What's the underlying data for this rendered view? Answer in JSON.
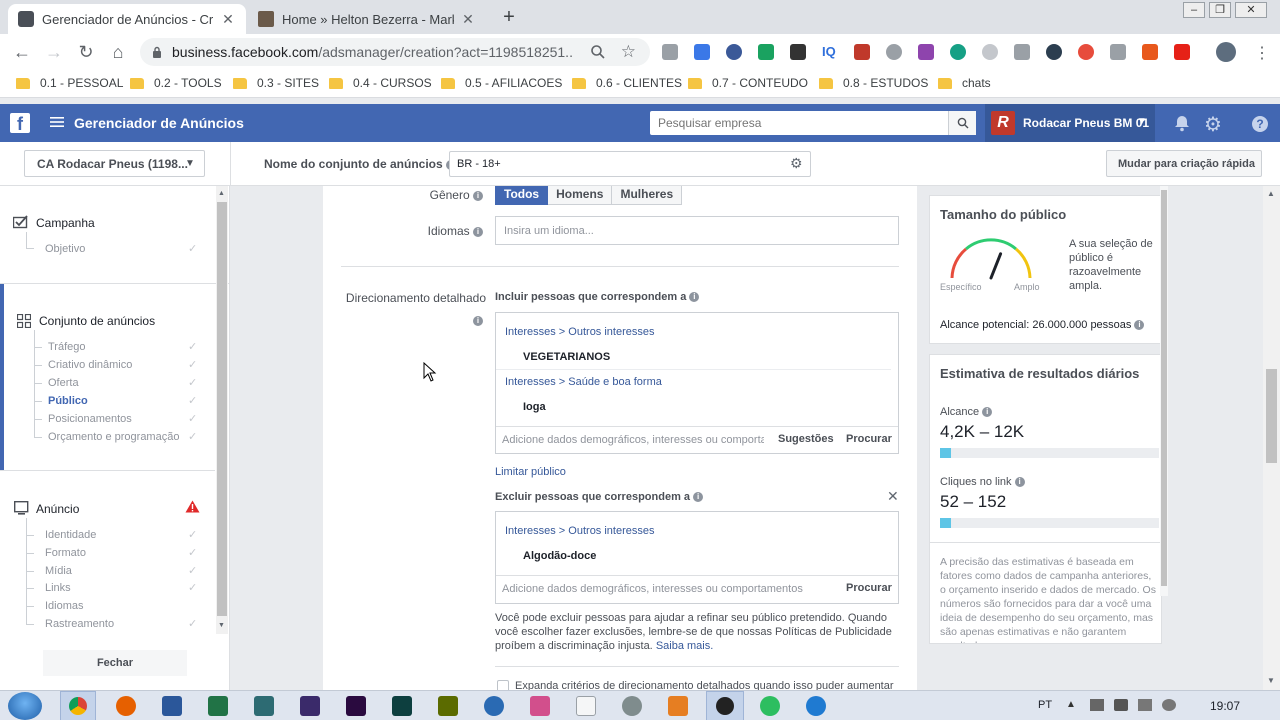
{
  "browser": {
    "tabs": [
      {
        "title": "Gerenciador de Anúncios - Criaç",
        "active": true
      },
      {
        "title": "Home » Helton Bezerra - Market",
        "active": false
      }
    ],
    "new_tab": "+",
    "url_domain": "business.facebook.com",
    "url_path": "/adsmanager/creation?act=1198518251...",
    "bookmarks": [
      "0.1 - PESSOAL",
      "0.2 - TOOLS",
      "0.3 - SITES",
      "0.4 - CURSOS",
      "0.5 - AFILIACOES",
      "0.6 - CLIENTES",
      "0.7 - CONTEUDO",
      "0.8 - ESTUDOS",
      "chats"
    ]
  },
  "fb_header": {
    "app_title": "Gerenciador de Anúncios",
    "search_placeholder": "Pesquisar empresa",
    "account_name": "Rodacar Pneus BM 01"
  },
  "subheader": {
    "ad_account": "CA Rodacar Pneus (1198...",
    "adset_name_label": "Nome do conjunto de anúncios",
    "adset_name_value": "BR - 18+",
    "quick_create_button": "Mudar para criação rápida"
  },
  "leftnav": {
    "campaign": {
      "label": "Campanha",
      "items": [
        "Objetivo"
      ]
    },
    "adset": {
      "label": "Conjunto de anúncios",
      "items": [
        "Tráfego",
        "Criativo dinâmico",
        "Oferta",
        "Público",
        "Posicionamentos",
        "Orçamento e programação"
      ],
      "active": "Público"
    },
    "ad": {
      "label": "Anúncio",
      "items": [
        "Identidade",
        "Formato",
        "Mídia",
        "Links",
        "Idiomas",
        "Rastreamento"
      ]
    },
    "close_button": "Fechar"
  },
  "form": {
    "gender_label": "Gênero",
    "gender_options": [
      "Todos",
      "Homens",
      "Mulheres"
    ],
    "gender_selected": "Todos",
    "languages_label": "Idiomas",
    "languages_placeholder": "Insira um idioma...",
    "detailed_label": "Direcionamento detalhado",
    "include_title": "Incluir pessoas que correspondem a",
    "include_groups": [
      {
        "category": "Interesses",
        "sub": "Outros interesses",
        "term": "VEGETARIANOS"
      },
      {
        "category": "Interesses",
        "sub": "Saúde e boa forma",
        "term": "Ioga"
      }
    ],
    "include_placeholder": "Adicione dados demográficos, interesses ou comportamentos",
    "suggestions_button": "Sugestões",
    "browse_button": "Procurar",
    "narrow_link": "Limitar público",
    "exclude_title": "Excluir pessoas que correspondem a",
    "exclude_groups": [
      {
        "category": "Interesses",
        "sub": "Outros interesses",
        "term": "Algodão-doce"
      }
    ],
    "exclude_placeholder": "Adicione dados demográficos, interesses ou comportamentos",
    "exclude_browse_button": "Procurar",
    "exclude_note": "Você pode excluir pessoas para ajudar a refinar seu público pretendido. Quando você escolher fazer exclusões, lembre-se de que nossas Políticas de Publicidade proíbem a discriminação injusta.",
    "learn_more_link": "Saiba mais.",
    "expand_checkbox_label": "Expanda critérios de direcionamento detalhados quando isso puder aumentar"
  },
  "audience_size": {
    "title": "Tamanho do público",
    "specific": "Específico",
    "broad": "Amplo",
    "gauge_level": 0.62,
    "description": "A sua seleção de público é razoavelmente ampla.",
    "potential_reach": "Alcance potencial: 26.000.000 pessoas"
  },
  "daily_results": {
    "title": "Estimativa de resultados diários",
    "reach_label": "Alcance",
    "reach_value": "4,2K – 12K",
    "reach_fill": 0.05,
    "clicks_label": "Cliques no link",
    "clicks_value": "52 – 152",
    "clicks_fill": 0.05,
    "note": "A precisão das estimativas é baseada em fatores como dados de campanha anteriores, o orçamento inserido e dados de mercado. Os números são fornecidos para dar a você uma ideia de desempenho do seu orçamento, mas são apenas estimativas e não garantem resultados."
  },
  "taskbar": {
    "lang": "PT",
    "time": "19:07"
  },
  "colors": {
    "fb_blue": "#4267b2",
    "link_blue": "#365899",
    "warning_red": "#e02a2a",
    "reach_bar": "#5ec5e6"
  }
}
